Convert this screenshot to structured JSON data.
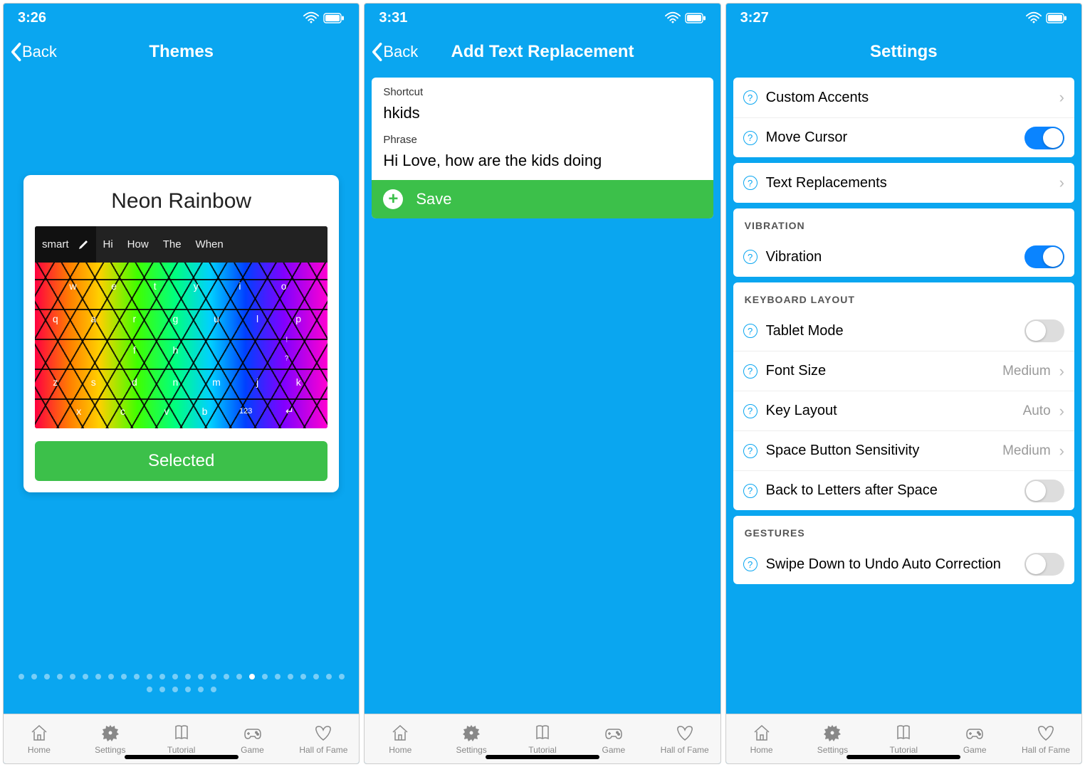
{
  "screens": [
    {
      "time": "3:26",
      "nav_back": "Back",
      "nav_title": "Themes",
      "themes": {
        "theme_name": "Neon Rainbow",
        "selected_label": "Selected",
        "smart_label": "smart",
        "suggestions": [
          "Hi",
          "How",
          "The",
          "When"
        ],
        "keyboard_rows": [
          [
            "w",
            "e",
            "t",
            "y",
            "i",
            "o"
          ],
          [
            "q",
            "a",
            "r",
            "g",
            "u",
            "l",
            "p"
          ],
          [
            "",
            "f",
            "h",
            "",
            "?"
          ],
          [
            "z",
            "s",
            "d",
            "n",
            "m",
            "j",
            "k"
          ],
          [
            "x",
            "c",
            "v",
            "b",
            "123",
            "↵"
          ]
        ]
      },
      "page_indicator": {
        "count": 32,
        "active_index": 18
      }
    },
    {
      "time": "3:31",
      "nav_back": "Back",
      "nav_title": "Add Text Replacement",
      "form": {
        "shortcut_label": "Shortcut",
        "shortcut_value": "hkids",
        "phrase_label": "Phrase",
        "phrase_value": "Hi Love, how are the kids doing",
        "save_label": "Save"
      }
    },
    {
      "time": "3:27",
      "nav_title": "Settings",
      "groups": [
        {
          "rows": [
            {
              "label": "Custom Accents",
              "type": "chevron"
            },
            {
              "label": "Move Cursor",
              "type": "toggle",
              "on": true
            }
          ]
        },
        {
          "rows": [
            {
              "label": "Text Replacements",
              "type": "chevron"
            }
          ]
        },
        {
          "header": "VIBRATION",
          "rows": [
            {
              "label": "Vibration",
              "type": "toggle",
              "on": true
            }
          ]
        },
        {
          "header": "KEYBOARD LAYOUT",
          "rows": [
            {
              "label": "Tablet Mode",
              "type": "toggle",
              "on": false
            },
            {
              "label": "Font Size",
              "type": "value",
              "value": "Medium"
            },
            {
              "label": "Key Layout",
              "type": "value",
              "value": "Auto"
            },
            {
              "label": "Space Button Sensitivity",
              "type": "value",
              "value": "Medium"
            },
            {
              "label": "Back to Letters after Space",
              "type": "toggle",
              "on": false
            }
          ]
        },
        {
          "header": "GESTURES",
          "rows": [
            {
              "label": "Swipe Down to Undo Auto Correction",
              "type": "toggle",
              "on": false
            }
          ]
        }
      ]
    }
  ],
  "tabbar": {
    "items": [
      "Home",
      "Settings",
      "Tutorial",
      "Game",
      "Hall of Fame"
    ]
  }
}
